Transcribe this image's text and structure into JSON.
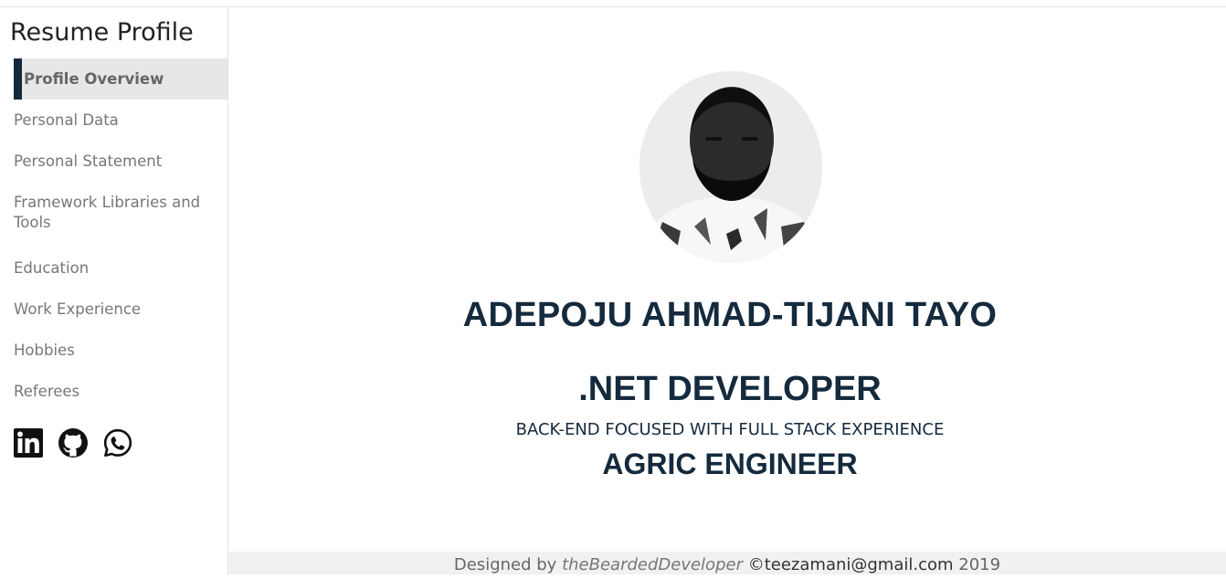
{
  "sidebar": {
    "brand": "Resume Profile",
    "items": [
      {
        "label": "Profile Overview",
        "active": true
      },
      {
        "label": "Personal Data"
      },
      {
        "label": "Personal Statement"
      },
      {
        "label": "Framework Libraries and Tools"
      },
      {
        "label": "Education"
      },
      {
        "label": "Work Experience"
      },
      {
        "label": "Hobbies"
      },
      {
        "label": "Referees"
      }
    ],
    "social": [
      "linkedin-icon",
      "github-icon",
      "whatsapp-icon"
    ]
  },
  "profile": {
    "name": "ADEPOJU AHMAD-TIJANI TAYO",
    "role": ".NET DEVELOPER",
    "focus": "BACK-END FOCUSED WITH FULL STACK EXPERIENCE",
    "profession": "AGRIC ENGINEER"
  },
  "footer": {
    "prefix": "Designed by",
    "author": "theBeardedDeveloper",
    "copyright": "©",
    "email": "teezamani@gmail.com",
    "year": "2019"
  },
  "colors": {
    "accent": "#15293c",
    "active_bg": "#e7e7e7",
    "footer_bg": "#f1f1f1"
  }
}
